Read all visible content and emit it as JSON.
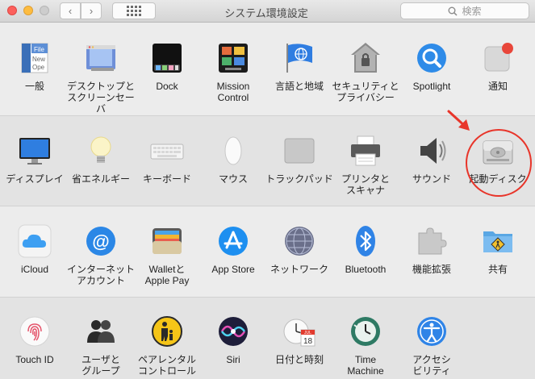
{
  "window": {
    "title": "システム環境設定",
    "search_placeholder": "検索",
    "nav_back": "‹",
    "nav_forward": "›"
  },
  "rows": [
    {
      "items": [
        {
          "id": "general",
          "label": "一般",
          "icon": "general-icon"
        },
        {
          "id": "desktop",
          "label": "デスクトップと\nスクリーンセーバ",
          "icon": "desktop-screensaver-icon"
        },
        {
          "id": "dock",
          "label": "Dock",
          "icon": "dock-icon"
        },
        {
          "id": "mission",
          "label": "Mission\nControl",
          "icon": "mission-control-icon"
        },
        {
          "id": "language",
          "label": "言語と地域",
          "icon": "language-region-icon"
        },
        {
          "id": "security",
          "label": "セキュリティと\nプライバシー",
          "icon": "security-icon"
        },
        {
          "id": "spotlight",
          "label": "Spotlight",
          "icon": "spotlight-icon"
        },
        {
          "id": "notifications",
          "label": "通知",
          "icon": "notifications-icon"
        }
      ]
    },
    {
      "items": [
        {
          "id": "displays",
          "label": "ディスプレイ",
          "icon": "display-icon"
        },
        {
          "id": "energy",
          "label": "省エネルギー",
          "icon": "energy-saver-icon"
        },
        {
          "id": "keyboard",
          "label": "キーボード",
          "icon": "keyboard-icon"
        },
        {
          "id": "mouse",
          "label": "マウス",
          "icon": "mouse-icon"
        },
        {
          "id": "trackpad",
          "label": "トラックパッド",
          "icon": "trackpad-icon"
        },
        {
          "id": "printers",
          "label": "プリンタと\nスキャナ",
          "icon": "printer-icon"
        },
        {
          "id": "sound",
          "label": "サウンド",
          "icon": "sound-icon"
        },
        {
          "id": "startup",
          "label": "起動ディスク",
          "icon": "startup-disk-icon"
        }
      ]
    },
    {
      "items": [
        {
          "id": "icloud",
          "label": "iCloud",
          "icon": "icloud-icon"
        },
        {
          "id": "internet",
          "label": "インターネット\nアカウント",
          "icon": "internet-accounts-icon"
        },
        {
          "id": "wallet",
          "label": "Walletと\nApple Pay",
          "icon": "wallet-icon"
        },
        {
          "id": "appstore",
          "label": "App Store",
          "icon": "app-store-icon"
        },
        {
          "id": "network",
          "label": "ネットワーク",
          "icon": "network-icon"
        },
        {
          "id": "bluetooth",
          "label": "Bluetooth",
          "icon": "bluetooth-icon"
        },
        {
          "id": "extensions",
          "label": "機能拡張",
          "icon": "extensions-icon"
        },
        {
          "id": "sharing",
          "label": "共有",
          "icon": "sharing-icon"
        }
      ]
    },
    {
      "items": [
        {
          "id": "touchid",
          "label": "Touch ID",
          "icon": "touch-id-icon"
        },
        {
          "id": "users",
          "label": "ユーザと\nグループ",
          "icon": "users-groups-icon"
        },
        {
          "id": "parental",
          "label": "ペアレンタル\nコントロール",
          "icon": "parental-controls-icon"
        },
        {
          "id": "siri",
          "label": "Siri",
          "icon": "siri-icon"
        },
        {
          "id": "datetime",
          "label": "日付と時刻",
          "icon": "date-time-icon"
        },
        {
          "id": "timemachine",
          "label": "Time\nMachine",
          "icon": "time-machine-icon"
        },
        {
          "id": "accessibility",
          "label": "アクセシ\nビリティ",
          "icon": "accessibility-icon"
        }
      ]
    }
  ],
  "calendar_day": "18",
  "calendar_month": "JUL",
  "highlight": {
    "target": "startup",
    "color": "#e8352a"
  }
}
